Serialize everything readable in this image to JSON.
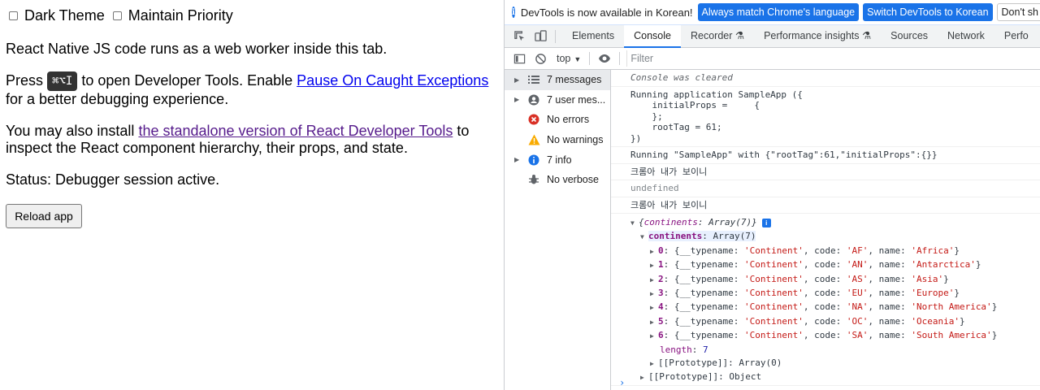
{
  "page": {
    "checkbox_dark": "Dark Theme",
    "checkbox_priority": "Maintain Priority",
    "p1": "React Native JS code runs as a web worker inside this tab.",
    "p2_before": "Press ",
    "p2_kbd": "⌘⌥I",
    "p2_mid": " to open Developer Tools. Enable ",
    "p2_link": "Pause On Caught Exceptions",
    "p2_after": " for a better debugging experience.",
    "p3_before": "You may also install ",
    "p3_link": "the standalone version of React Developer Tools",
    "p3_after": " to inspect the React component hierarchy, their props, and state.",
    "status": "Status: Debugger session active.",
    "reload": "Reload app"
  },
  "devtools": {
    "infobar": {
      "message": "DevTools is now available in Korean!",
      "btn_match": "Always match Chrome's language",
      "btn_switch": "Switch DevTools to Korean",
      "btn_dont": "Don't sh"
    },
    "tabs": [
      "Elements",
      "Console",
      "Recorder ⚗",
      "Performance insights ⚗",
      "Sources",
      "Network",
      "Perfo"
    ],
    "context": "top",
    "filter_placeholder": "Filter",
    "sidebar": [
      {
        "label": "7 messages",
        "icon": "list-icon"
      },
      {
        "label": "7 user mes...",
        "icon": "user-icon"
      },
      {
        "label": "No errors",
        "icon": "error-icon"
      },
      {
        "label": "No warnings",
        "icon": "warning-icon"
      },
      {
        "label": "7 info",
        "icon": "info-icon"
      },
      {
        "label": "No verbose",
        "icon": "bug-icon"
      }
    ],
    "console": {
      "cleared": "Console was cleared",
      "running_app": "Running application SampleApp ({\n    initialProps =     {\n    };\n    rootTag = 61;\n})",
      "running_json": "Running \"SampleApp\" with {\"rootTag\":61,\"initialProps\":{}}",
      "korean1": "크롬아 내가 보이니",
      "undefined": "undefined",
      "korean2": "크롬아 내가 보이니",
      "obj_summary_key": "continents",
      "obj_summary_val": "Array(7)",
      "continents_key": "continents",
      "continents_val": "Array(7)",
      "items": [
        {
          "idx": "0",
          "typename": "'Continent'",
          "code": "'AF'",
          "name": "'Africa'"
        },
        {
          "idx": "1",
          "typename": "'Continent'",
          "code": "'AN'",
          "name": "'Antarctica'"
        },
        {
          "idx": "2",
          "typename": "'Continent'",
          "code": "'AS'",
          "name": "'Asia'"
        },
        {
          "idx": "3",
          "typename": "'Continent'",
          "code": "'EU'",
          "name": "'Europe'"
        },
        {
          "idx": "4",
          "typename": "'Continent'",
          "code": "'NA'",
          "name": "'North America'"
        },
        {
          "idx": "5",
          "typename": "'Continent'",
          "code": "'OC'",
          "name": "'Oceania'"
        },
        {
          "idx": "6",
          "typename": "'Continent'",
          "code": "'SA'",
          "name": "'South America'"
        }
      ],
      "length_key": "length",
      "length_val": "7",
      "proto_array": "[[Prototype]]: Array(0)",
      "proto_object": "[[Prototype]]: Object",
      "prompt": "›"
    }
  },
  "colors": {
    "accent": "#1a73e8",
    "string": "#c41a16",
    "key": "#881280",
    "number": "#1a1aa6"
  }
}
